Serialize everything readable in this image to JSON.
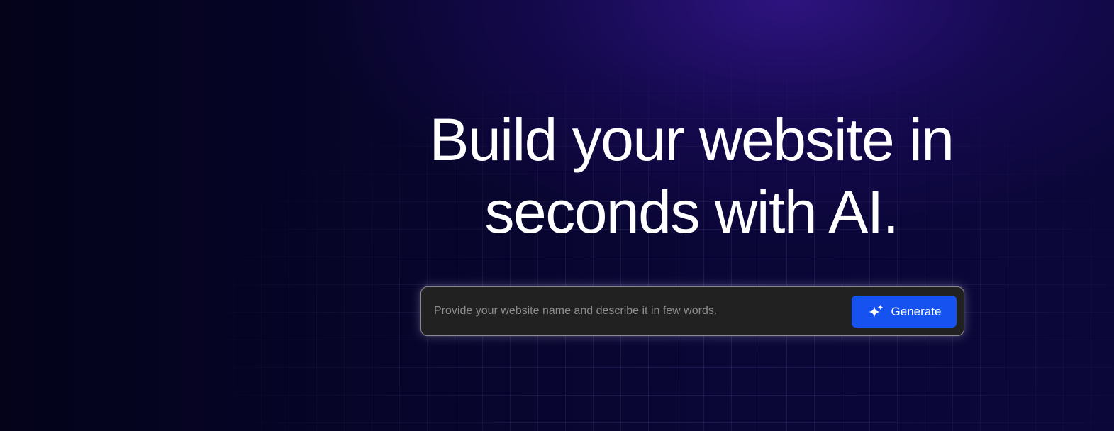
{
  "hero": {
    "headline_line1": "Build your website in",
    "headline_line2": "seconds with AI.",
    "prompt": {
      "value": "",
      "placeholder": "Provide your website name and describe it in few words."
    },
    "generate_button": {
      "label": "Generate",
      "icon": "sparkle-icon"
    }
  },
  "colors": {
    "background": "#07052a",
    "accent_glow": "#34168c",
    "button": "#1552f0",
    "input_bg": "#212121",
    "text": "#ffffff"
  }
}
